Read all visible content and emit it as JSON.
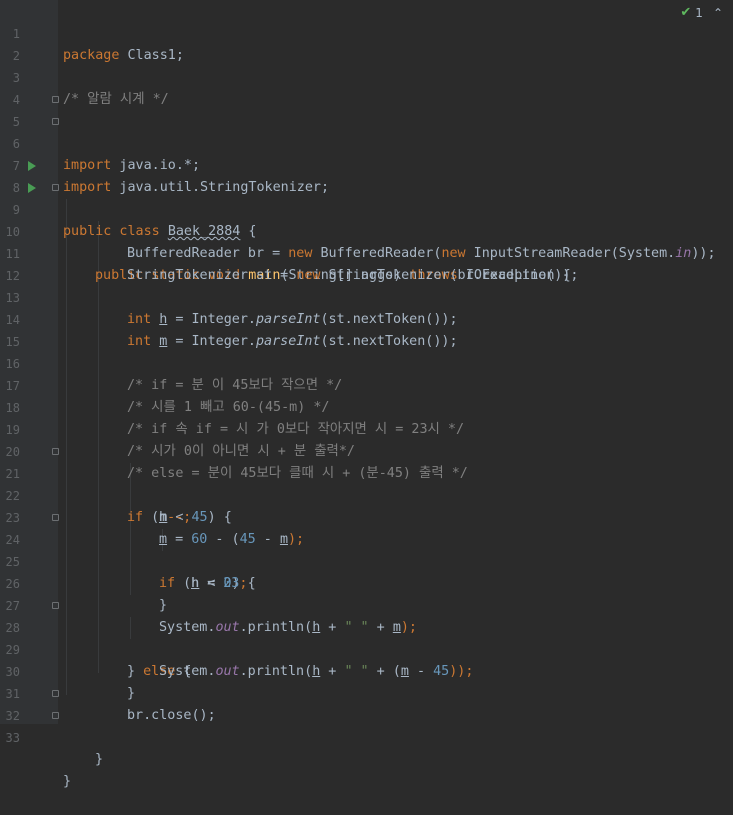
{
  "editor": {
    "inspection": {
      "icon": "check-icon",
      "count": "1",
      "nav": "up-caret-icon"
    },
    "lines": [
      {
        "n": "1"
      },
      {
        "n": "2"
      },
      {
        "n": "3"
      },
      {
        "n": "4"
      },
      {
        "n": "5"
      },
      {
        "n": "6"
      },
      {
        "n": "7"
      },
      {
        "n": "8"
      },
      {
        "n": "9"
      },
      {
        "n": "10"
      },
      {
        "n": "11"
      },
      {
        "n": "12"
      },
      {
        "n": "13"
      },
      {
        "n": "14"
      },
      {
        "n": "15"
      },
      {
        "n": "16"
      },
      {
        "n": "17"
      },
      {
        "n": "18"
      },
      {
        "n": "19"
      },
      {
        "n": "20"
      },
      {
        "n": "21"
      },
      {
        "n": "22"
      },
      {
        "n": "23"
      },
      {
        "n": "24"
      },
      {
        "n": "25"
      },
      {
        "n": "26"
      },
      {
        "n": "27"
      },
      {
        "n": "28"
      },
      {
        "n": "29"
      },
      {
        "n": "30"
      },
      {
        "n": "31"
      },
      {
        "n": "32"
      },
      {
        "n": "33"
      }
    ],
    "tokens": {
      "l1": [
        "package",
        " Class1;"
      ],
      "l3": "/* 알람 시계 */",
      "l5": [
        "import",
        " java.io.*;"
      ],
      "l6": [
        "import",
        " java.util.StringTokenizer;"
      ],
      "l8": [
        "public class ",
        "Baek_2884",
        " {"
      ],
      "l9": [
        "public static void ",
        "main",
        "(String[] args) ",
        "throws",
        " IOException {"
      ],
      "l10": [
        "BufferedReader br = ",
        "new",
        " BufferedReader(",
        "new",
        " InputStreamReader(System.",
        "in",
        "));"
      ],
      "l11": [
        "StringTokenizer st = ",
        "new",
        " StringTokenizer(br.readLine());"
      ],
      "l13": [
        "int",
        " ",
        "h",
        " = Integer.",
        "parseInt",
        "(st.nextToken());"
      ],
      "l14": [
        "int",
        " ",
        "m",
        " = Integer.",
        "parseInt",
        "(st.nextToken());"
      ],
      "l16": "/* if = 분 이 45보다 작으면 */",
      "l17": "/* 시를 1 빼고 60-(45-m) */",
      "l18": "/* if 속 if = 시 가 0보다 작아지면 시 = 23시 */",
      "l19": "/* 시가 0이 아니면 시 + 분 출력*/",
      "l20": "/* else = 분이 45보다 클때 시 + (분-45) 출력 */",
      "l21": [
        "if",
        " (",
        "m",
        " < ",
        "45",
        ") {"
      ],
      "l22": [
        "h",
        "--;"
      ],
      "l23": [
        "m",
        " = ",
        "60",
        " - (",
        "45",
        " - ",
        "m",
        ");"
      ],
      "l24": [
        "if",
        " (",
        "h",
        " < ",
        "0",
        ") {"
      ],
      "l25": [
        "h",
        " = ",
        "23",
        ";"
      ],
      "l26": "}",
      "l27": [
        "System.",
        "out",
        ".println(",
        "h",
        " + ",
        "\" \"",
        " + ",
        "m",
        ");"
      ],
      "l28": [
        "} ",
        "else",
        " {"
      ],
      "l29": [
        "System.",
        "out",
        ".println(",
        "h",
        " + ",
        "\" \"",
        " + (",
        "m",
        " - ",
        "45",
        "));"
      ],
      "l30": "}",
      "l31": "br.close();",
      "l32": "}",
      "l33": "}"
    }
  }
}
